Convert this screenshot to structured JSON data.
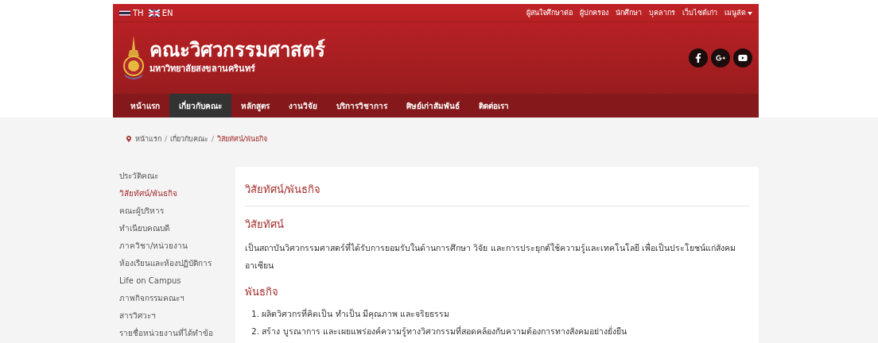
{
  "languages": [
    {
      "code": "TH",
      "kind": "thai"
    },
    {
      "code": "EN",
      "kind": "british"
    }
  ],
  "top_links": [
    "ผู้สนใจศึกษาต่อ",
    "ผู้ปกครอง",
    "นักศึกษา",
    "บุคลากร",
    "เว็บไซต์เก่า"
  ],
  "quick_menu": {
    "label": "เมนูลัด"
  },
  "logo": {
    "title": "คณะวิศวกรรมศาสตร์",
    "subtitle": "มหาวิทยาลัยสงขลานครินทร์"
  },
  "social": [
    {
      "kind": "facebook"
    },
    {
      "kind": "googleplus"
    },
    {
      "kind": "youtube"
    }
  ],
  "nav": [
    {
      "label": "หน้าแรก",
      "selected": false
    },
    {
      "label": "เกี่ยวกับคณะ",
      "selected": true
    },
    {
      "label": "หลักสูตร",
      "selected": false
    },
    {
      "label": "งานวิจัย",
      "selected": false
    },
    {
      "label": "บริการวิชาการ",
      "selected": false
    },
    {
      "label": "ศิษย์เก่าสัมพันธ์",
      "selected": false
    },
    {
      "label": "ติดต่อเรา",
      "selected": false
    }
  ],
  "breadcrumb": {
    "separator": "/",
    "items": [
      "หน้าแรก",
      "เกี่ยวกับคณะ",
      "วิสัยทัศน์/พันธกิจ"
    ]
  },
  "sidebar": {
    "items": [
      {
        "label": "ประวัติคณะ",
        "selected": false
      },
      {
        "label": "วิสัยทัศน์/พันธกิจ",
        "selected": true
      },
      {
        "label": "คณะผู้บริหาร",
        "selected": false
      },
      {
        "label": "ทำเนียบคณบดี",
        "selected": false
      },
      {
        "label": "ภาควิชา/หน่วยงาน",
        "selected": false
      },
      {
        "label": "ห้องเรียนและห้องปฏิบัติการ",
        "selected": false
      },
      {
        "label": "Life on Campus",
        "selected": false
      },
      {
        "label": "ภาพกิจกรรมคณะฯ",
        "selected": false
      },
      {
        "label": "สารวิศวะฯ",
        "selected": false
      },
      {
        "label": "รายชื่อหน่วยงานที่ได้ทำข้อ",
        "selected": false
      }
    ]
  },
  "article": {
    "title": "วิสัยทัศน์/พันธกิจ",
    "sections": [
      {
        "heading": "วิสัยทัศน์",
        "kind": "paragraph",
        "text": "เป็นสถาบันวิศวกรรมศาสตร์ที่ได้รับการยอมรับในด้านการศึกษา วิจัย และการประยุกต์ใช้ความรู้และเทคโนโลยี เพื่อเป็นประโยชน์แก่สังคมอาเซียน"
      },
      {
        "heading": "พันธกิจ",
        "kind": "list",
        "items": [
          "1. ผลิตวิศวกรที่คิดเป็น ทำเป็น มีคุณภาพ และจริยธรรม",
          "2. สร้าง บูรณาการ และเผยแพร่องค์ความรู้ทางวิศวกรรมที่สอดคล้องกับความต้องการทางสังคมอย่างยั่งยืน"
        ]
      }
    ]
  }
}
